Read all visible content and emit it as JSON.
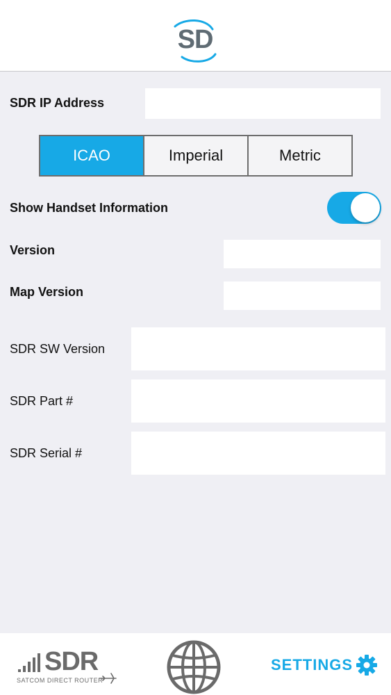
{
  "header": {
    "logo_text": "SD"
  },
  "settings": {
    "ip_address": {
      "label": "SDR IP Address",
      "value": ""
    },
    "units": {
      "options": [
        "ICAO",
        "Imperial",
        "Metric"
      ],
      "selected": "ICAO"
    },
    "show_handset": {
      "label": "Show Handset Information",
      "enabled": true
    },
    "version": {
      "label": "Version",
      "value": ""
    },
    "map_version": {
      "label": "Map Version",
      "value": ""
    },
    "sdr_sw_version": {
      "label": "SDR SW Version",
      "value": ""
    },
    "sdr_part": {
      "label": "SDR Part #",
      "value": ""
    },
    "sdr_serial": {
      "label": "SDR Serial #",
      "value": ""
    }
  },
  "footer": {
    "brand_text": "SDR",
    "brand_subtitle": "SATCOM DIRECT ROUTER",
    "settings_label": "SETTINGS"
  },
  "colors": {
    "accent": "#17a9e6",
    "background": "#efeff4",
    "header_bg": "#ffffff",
    "logo_gray": "#5f6b73"
  },
  "icons": {
    "logo": "sd-swoosh-logo",
    "signal": "signal-bars-icon",
    "plane": "airplane-icon",
    "globe": "globe-icon",
    "gear": "gear-icon"
  }
}
